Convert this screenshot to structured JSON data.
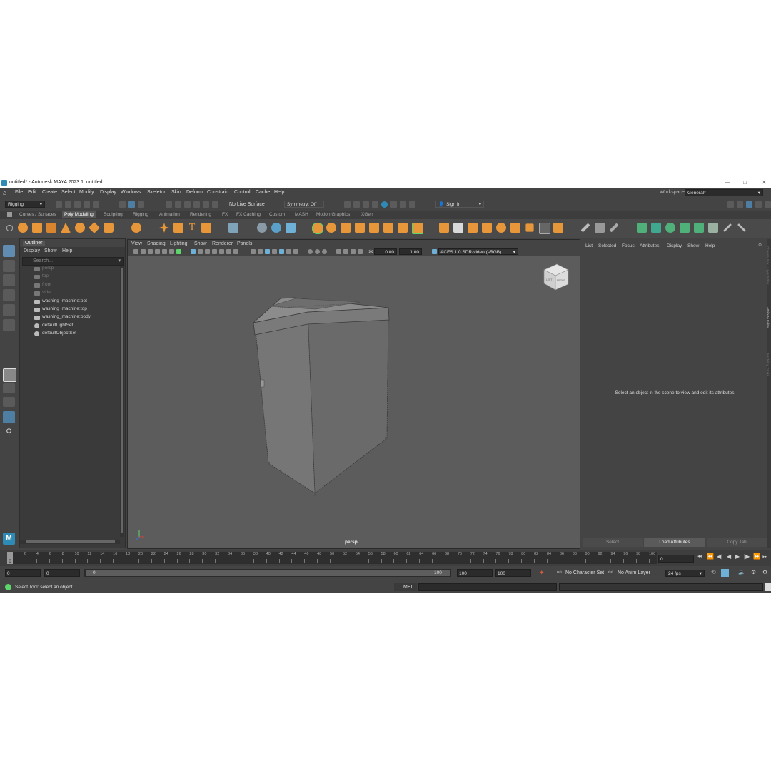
{
  "window": {
    "title": "untitled* - Autodesk MAYA 2023.1: untitled",
    "controls": [
      "—",
      "□",
      "✕"
    ]
  },
  "menu": [
    "File",
    "Edit",
    "Create",
    "Select",
    "Modify",
    "Display",
    "Windows",
    "Skeleton",
    "Skin",
    "Deform",
    "Constrain",
    "Control",
    "Cache",
    "Help"
  ],
  "workspace": {
    "label": "Workspace:",
    "value": "General*"
  },
  "status_line": {
    "menuset": "Rigging",
    "live_surface": "No Live Surface",
    "symmetry": "Symmetry: Off",
    "sign_in": "Sign In"
  },
  "shelf_tabs": [
    "Curves / Surfaces",
    "Poly Modeling",
    "Sculpting",
    "Rigging",
    "Animation",
    "Rendering",
    "FX",
    "FX Caching",
    "Custom",
    "MASH",
    "Motion Graphics",
    "XGen"
  ],
  "active_shelf_tab": "Poly Modeling",
  "outliner": {
    "title": "Outliner",
    "menu": [
      "Display",
      "Show",
      "Help"
    ],
    "search_placeholder": "Search...",
    "items": [
      {
        "label": "persp",
        "dim": true
      },
      {
        "label": "top",
        "dim": true
      },
      {
        "label": "front",
        "dim": true
      },
      {
        "label": "side",
        "dim": true
      },
      {
        "label": "washing_machine:pot",
        "dim": false
      },
      {
        "label": "washing_machine:top",
        "dim": false
      },
      {
        "label": "washing_machine:body",
        "dim": false
      },
      {
        "label": "defaultLightSet",
        "dim": false
      },
      {
        "label": "defaultObjectSet",
        "dim": false
      }
    ]
  },
  "viewport": {
    "menu": [
      "View",
      "Shading",
      "Lighting",
      "Show",
      "Renderer",
      "Panels"
    ],
    "exposure": "0.00",
    "gamma": "1.00",
    "color_space": "ACES 1.0 SDR-video (sRGB)",
    "camera_label": "persp",
    "viewcube": {
      "left": "LEFT",
      "front": "FRONT"
    }
  },
  "attribute_editor": {
    "menu": [
      "List",
      "Selected",
      "Focus",
      "Attributes",
      "Display",
      "Show",
      "Help"
    ],
    "message": "Select an object in the scene to view and edit its attributes",
    "buttons": [
      "Select",
      "Load Attributes",
      "Copy Tab"
    ]
  },
  "side_tabs": [
    "Channel Box / Layer Editor",
    "Attribute Editor",
    "Modeling Toolkit"
  ],
  "timeline": {
    "ticks": [
      "0",
      "2",
      "4",
      "6",
      "8",
      "10",
      "12",
      "14",
      "16",
      "18",
      "20",
      "22",
      "24",
      "26",
      "28",
      "30",
      "32",
      "34",
      "36",
      "38",
      "40",
      "42",
      "44",
      "46",
      "48",
      "50",
      "52",
      "54",
      "56",
      "58",
      "60",
      "62",
      "64",
      "66",
      "68",
      "70",
      "72",
      "74",
      "76",
      "78",
      "80",
      "82",
      "84",
      "86",
      "88",
      "90",
      "92",
      "94",
      "96",
      "98",
      "100"
    ],
    "current_frame": "0",
    "current_field": "0"
  },
  "range": {
    "start": "0",
    "playback_start": "0",
    "slider_start": "0",
    "slider_end": "100",
    "playback_end": "100",
    "end": "100",
    "character_set": "No Character Set",
    "anim_layer": "No Anim Layer",
    "fps": "24 fps"
  },
  "status": {
    "help": "Select Tool: select an object",
    "script_type": "MEL"
  },
  "colors": {
    "accent": "#2d8bb5",
    "shelf_orange": "#e8963a",
    "viewport_bg": "#5c5c5c"
  }
}
